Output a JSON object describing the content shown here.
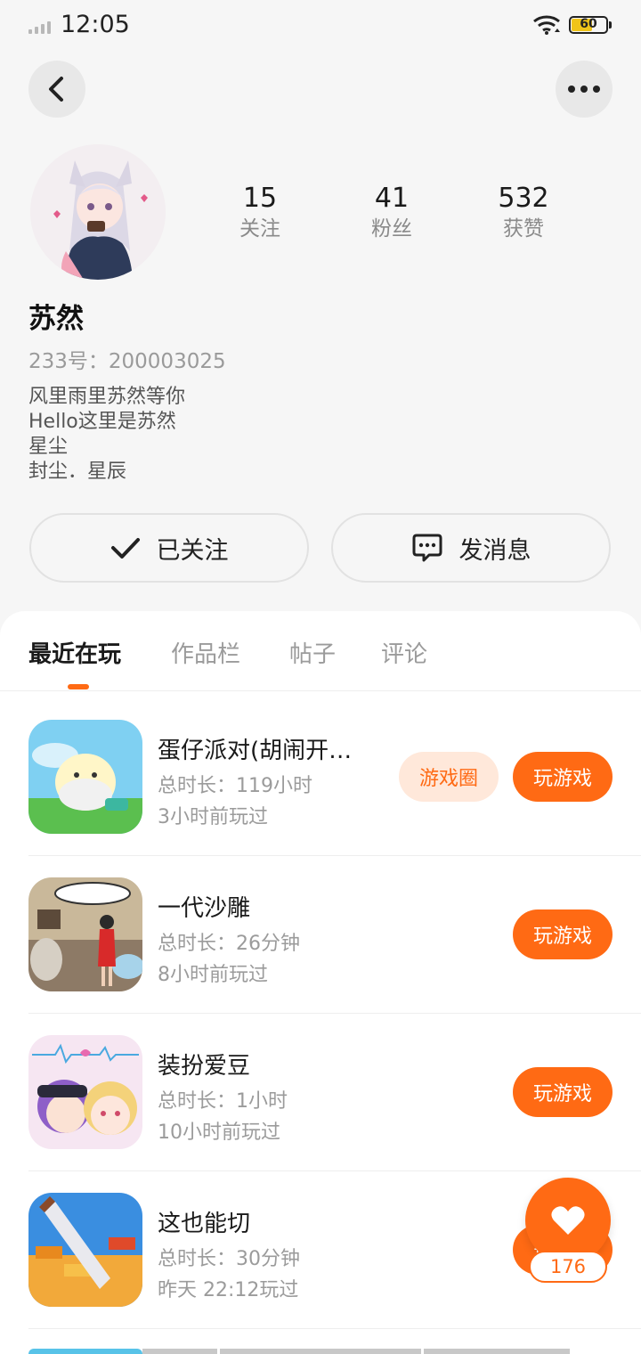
{
  "status_bar": {
    "time": "12:05",
    "battery": "60"
  },
  "profile": {
    "stats": [
      {
        "value": "15",
        "label": "关注"
      },
      {
        "value": "41",
        "label": "粉丝"
      },
      {
        "value": "532",
        "label": "获赞"
      }
    ],
    "nickname": "苏然",
    "uid": "233号：200003025",
    "bio": [
      "风里雨里苏然等你",
      "Hello这里是苏然",
      "星尘",
      "封尘．星辰"
    ]
  },
  "actions": {
    "follow_label": "已关注",
    "message_label": "发消息"
  },
  "tabs": [
    "最近在玩",
    "作品栏",
    "帖子",
    "评论"
  ],
  "games": [
    {
      "title": "蛋仔派对(胡闹开…",
      "duration": "总时长：119小时",
      "last_played": "3小时前玩过",
      "circle_label": "游戏圈",
      "play_label": "玩游戏"
    },
    {
      "title": "一代沙雕",
      "duration": "总时长：26分钟",
      "last_played": "8小时前玩过",
      "play_label": "玩游戏"
    },
    {
      "title": "装扮爱豆",
      "duration": "总时长：1小时",
      "last_played": "10小时前玩过",
      "play_label": "玩游戏"
    },
    {
      "title": "这也能切",
      "duration": "总时长：30分钟",
      "last_played": "昨天 22:12玩过",
      "play_label": "玩游戏"
    }
  ],
  "like": {
    "count": "176"
  },
  "colors": {
    "accent": "#ff6a14",
    "accent_light": "#ffe8da"
  }
}
